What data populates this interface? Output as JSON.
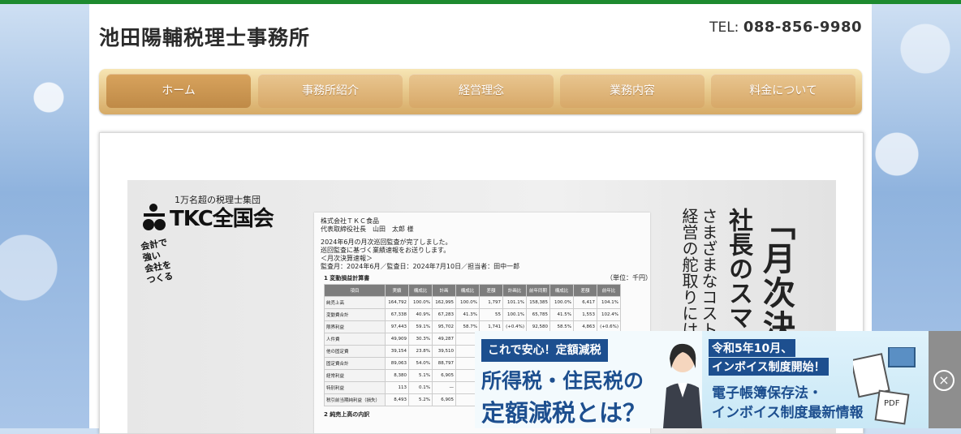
{
  "header": {
    "site_title": "池田陽輔税理士事務所",
    "tel_label": "TEL:",
    "tel_number": "088-856-9980"
  },
  "nav": {
    "items": [
      {
        "label": "ホーム"
      },
      {
        "label": "事務所紹介"
      },
      {
        "label": "経営理念"
      },
      {
        "label": "業務内容"
      },
      {
        "label": "料金について"
      }
    ]
  },
  "flyer": {
    "tkc_sub": "1万名超の税理士集団",
    "tkc_name": "TKC全国会",
    "stamp": [
      "会計で",
      "強い",
      "会社を",
      "つくる"
    ],
    "report": {
      "line1": "株式会社ＴＫＣ食品",
      "line2": "代表取締役社長　山田　太郎 様",
      "line3": "2024年6月の月次巡回監査が完了しました。",
      "line4": "巡回監査に基づく業績速報をお送りします。",
      "line5": "＜月次決算速報＞",
      "line6": "監査月：2024年6月／監査日：2024年7月10日／担当者：田中一郎",
      "section1": "1 変動損益計算書",
      "section2": "2 純売上高の内訳",
      "headers": [
        "項目",
        "実績",
        "構成比",
        "計画",
        "構成比",
        "差額",
        "計画比",
        "前年同期",
        "構成比",
        "差額",
        "前年比"
      ],
      "rows": [
        [
          "純売上高",
          "164,792",
          "100.0%",
          "162,995",
          "100.0%",
          "1,797",
          "101.1%",
          "158,385",
          "100.0%",
          "6,417",
          "104.1%"
        ],
        [
          "変動費合計",
          "67,338",
          "40.9%",
          "67,283",
          "41.3%",
          "55",
          "100.1%",
          "65,785",
          "41.5%",
          "1,553",
          "102.4%"
        ],
        [
          "限界利益",
          "97,443",
          "59.1%",
          "95,702",
          "58.7%",
          "1,741",
          "(+0.4%)",
          "92,580",
          "58.5%",
          "4,863",
          "(+0.6%)"
        ],
        [
          "人件費",
          "49,909",
          "30.3%",
          "49,287",
          "",
          "",
          "",
          "",
          "",
          "",
          ""
        ],
        [
          "他の固定費",
          "39,154",
          "23.8%",
          "39,510",
          "",
          "",
          "",
          "",
          "",
          "",
          ""
        ],
        [
          "固定費合計",
          "89,063",
          "54.0%",
          "88,797",
          "",
          "",
          "",
          "",
          "",
          "",
          ""
        ],
        [
          "経常利益",
          "8,380",
          "5.1%",
          "6,905",
          "",
          "",
          "",
          "",
          "",
          "",
          ""
        ],
        [
          "特別利益",
          "113",
          "0.1%",
          "—",
          "",
          "",
          "",
          "",
          "",
          "",
          ""
        ],
        [
          "税引前当期純利益（損失）",
          "8,493",
          "5.2%",
          "6,905",
          "",
          "",
          "",
          "",
          "",
          "",
          ""
        ]
      ],
      "unit": "（単位：千円）"
    },
    "vertical": [
      "「月次決算速",
      "社長のスマ",
      "さまざまなコストが",
      "経営の舵取りには「"
    ]
  },
  "ad": {
    "tag": "これで安心！定額減税",
    "head1": "所得税・住民税の",
    "head2": "定額減税とは？",
    "right_b1": "令和5年10月、",
    "right_b2": "インボイス制度開始！",
    "right_t1": "電子帳簿保存法・",
    "right_t2": "インボイス制度最新情報",
    "pdf_label": "PDF",
    "close": "×"
  }
}
